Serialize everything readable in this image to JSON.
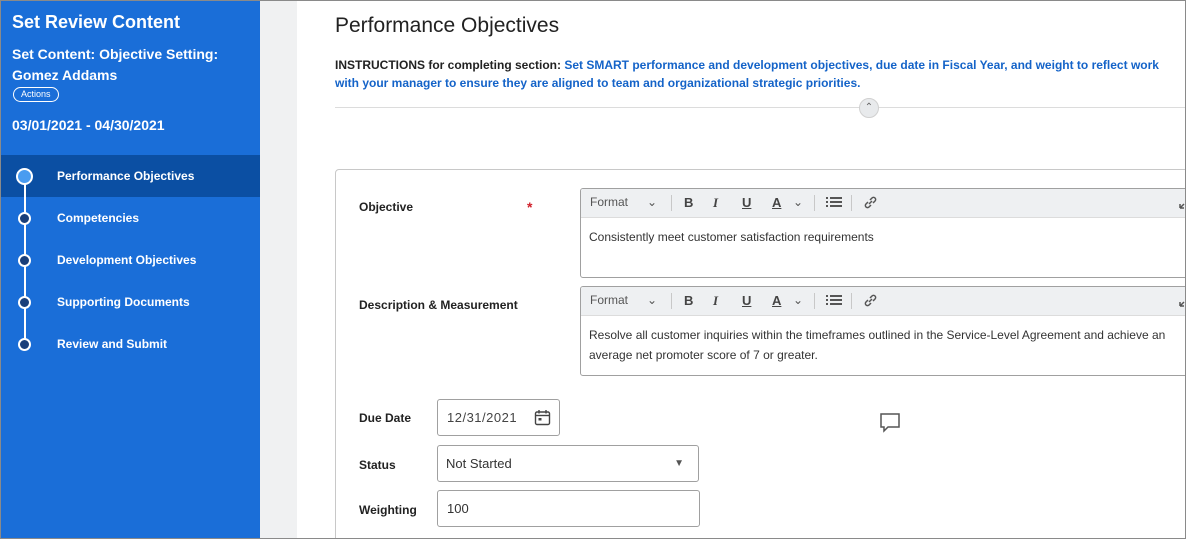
{
  "sidebar": {
    "title": "Set Review Content",
    "subtitle": "Set Content: Objective Setting: Gomez Addams",
    "actions_label": "Actions",
    "dates": "03/01/2021 - 04/30/2021",
    "steps": [
      {
        "label": "Performance Objectives",
        "active": true
      },
      {
        "label": "Competencies",
        "active": false
      },
      {
        "label": "Development Objectives",
        "active": false
      },
      {
        "label": "Supporting Documents",
        "active": false
      },
      {
        "label": "Review and Submit",
        "active": false
      }
    ]
  },
  "main": {
    "title": "Performance Objectives",
    "instructions_prefix": "INSTRUCTIONS for completing section: ",
    "instructions_line1": "Set SMART performance and development objectives, due date in Fiscal Year, and weight to reflect work",
    "instructions_line2": "with your manager to ensure they are aligned to team and organizational strategic priorities.",
    "form": {
      "objective_label": "Objective",
      "required_marker": "*",
      "objective_value": "Consistently meet customer satisfaction requirements",
      "description_label": "Description & Measurement",
      "description_value": "Resolve all customer inquiries within the timeframes outlined in the Service-Level Agreement and achieve an average net promoter score of 7 or greater.",
      "due_date_label": "Due Date",
      "due_date_value": "12/31/2021",
      "status_label": "Status",
      "status_value": "Not Started",
      "weighting_label": "Weighting",
      "weighting_value": "100"
    },
    "toolbar": {
      "format_label": "Format",
      "bold": "B",
      "italic": "I",
      "underline": "U",
      "text_color": "A"
    }
  },
  "colors": {
    "sidebar_bg": "#1a6ed8",
    "sidebar_active": "#0b4fa3",
    "accent_text": "#1463c8",
    "required": "#d01f2a"
  }
}
